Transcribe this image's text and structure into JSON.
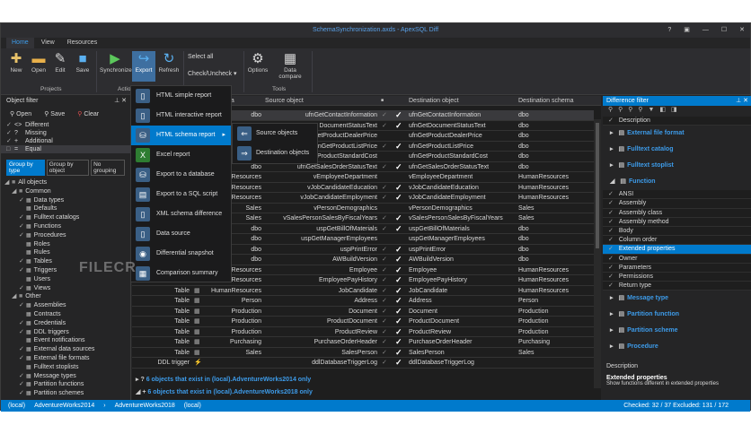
{
  "window": {
    "title": "SchemaSynchronization.axds - ApexSQL Diff",
    "buttons": [
      "?",
      "▣",
      "—",
      "☐",
      "✕"
    ]
  },
  "tabs": [
    "Home",
    "View",
    "Resources"
  ],
  "ribbon": {
    "new": "New",
    "open": "Open",
    "edit": "Edit",
    "save": "Save",
    "synchronize": "Synchronize",
    "export": "Export",
    "refresh": "Refresh",
    "select_all": "Select all",
    "check_uncheck": "Check/Uncheck ▾",
    "options": "Options",
    "data_compare": "Data compare",
    "groups": {
      "projects": "Projects",
      "action": "Action",
      "tools": "Tools"
    }
  },
  "object_filter": {
    "title": "Object filter",
    "open": "Open",
    "save": "Save",
    "clear": "Clear",
    "status": [
      {
        "sym": "<>",
        "label": "Different",
        "checked": true
      },
      {
        "sym": "?",
        "label": "Missing",
        "checked": true
      },
      {
        "sym": "+",
        "label": "Additional",
        "checked": true
      },
      {
        "sym": "=",
        "label": "Equal",
        "checked": false
      }
    ],
    "grouping": [
      "Group by type",
      "Group by object",
      "No grouping"
    ],
    "tree": [
      {
        "label": "All objects",
        "level": 0
      },
      {
        "label": "Common",
        "level": 1
      },
      {
        "label": "Data types",
        "level": 2,
        "checked": true
      },
      {
        "label": "Defaults",
        "level": 2,
        "checked": false
      },
      {
        "label": "Fulltext catalogs",
        "level": 2,
        "checked": true
      },
      {
        "label": "Functions",
        "level": 2,
        "checked": true
      },
      {
        "label": "Procedures",
        "level": 2,
        "checked": true
      },
      {
        "label": "Roles",
        "level": 2,
        "checked": false
      },
      {
        "label": "Rules",
        "level": 2,
        "checked": false
      },
      {
        "label": "Tables",
        "level": 2,
        "checked": true
      },
      {
        "label": "Triggers",
        "level": 2,
        "checked": true
      },
      {
        "label": "Users",
        "level": 2,
        "checked": false
      },
      {
        "label": "Views",
        "level": 2,
        "checked": true
      },
      {
        "label": "Other",
        "level": 1
      },
      {
        "label": "Assemblies",
        "level": 2,
        "checked": true
      },
      {
        "label": "Contracts",
        "level": 2,
        "checked": false
      },
      {
        "label": "Credentials",
        "level": 2,
        "checked": true
      },
      {
        "label": "DDL triggers",
        "level": 2,
        "checked": true
      },
      {
        "label": "Event notifications",
        "level": 2,
        "checked": false
      },
      {
        "label": "External data sources",
        "level": 2,
        "checked": true
      },
      {
        "label": "External file formats",
        "level": 2,
        "checked": true
      },
      {
        "label": "Fulltext stoplists",
        "level": 2,
        "checked": false
      },
      {
        "label": "Message types",
        "level": 2,
        "checked": true
      },
      {
        "label": "Partition functions",
        "level": 2,
        "checked": true
      },
      {
        "label": "Partition schemes",
        "level": 2,
        "checked": true
      }
    ]
  },
  "grid": {
    "headers": {
      "schema": "na",
      "source_object": "Source object",
      "check": "■",
      "dest_object": "Destination object",
      "dest_schema": "Destination schema"
    },
    "rows": [
      {
        "type": "",
        "src_schema": "dbo",
        "src": "ufnGetContactInformation",
        "chk": true,
        "dst": "ufnGetContactInformation",
        "dst_schema": "dbo"
      },
      {
        "type": "",
        "src_schema": "",
        "src": "DocumentStatusText",
        "chk": true,
        "dst": "ufnGetDocumentStatusText",
        "dst_schema": "dbo"
      },
      {
        "type": "",
        "src_schema": "",
        "src": "etProductDealerPrice",
        "chk": false,
        "dst": "ufnGetProductDealerPrice",
        "dst_schema": "dbo"
      },
      {
        "type": "",
        "src_schema": "",
        "src": "fnGetProductListPrice",
        "chk": true,
        "dst": "ufnGetProductListPrice",
        "dst_schema": "dbo"
      },
      {
        "type": "",
        "src_schema": "",
        "src": "ufnGetProductStandardCost",
        "chk": false,
        "dst": "ufnGetProductStandardCost",
        "dst_schema": "dbo"
      },
      {
        "type": "",
        "src_schema": "dbo",
        "src": "ufnGetSalesOrderStatusText",
        "chk": true,
        "dst": "ufnGetSalesOrderStatusText",
        "dst_schema": "dbo"
      },
      {
        "type": "",
        "src_schema": "nResources",
        "src": "vEmployeeDepartment",
        "chk": false,
        "dst": "vEmployeeDepartment",
        "dst_schema": "HumanResources"
      },
      {
        "type": "",
        "src_schema": "nResources",
        "src": "vJobCandidateEducation",
        "chk": true,
        "dst": "vJobCandidateEducation",
        "dst_schema": "HumanResources"
      },
      {
        "type": "",
        "src_schema": "nResources",
        "src": "vJobCandidateEmployment",
        "chk": true,
        "dst": "vJobCandidateEmployment",
        "dst_schema": "HumanResources"
      },
      {
        "type": "",
        "src_schema": "Sales",
        "src": "vPersonDemographics",
        "chk": false,
        "dst": "vPersonDemographics",
        "dst_schema": "Sales"
      },
      {
        "type": "",
        "src_schema": "Sales",
        "src": "vSalesPersonSalesByFiscalYears",
        "chk": true,
        "dst": "vSalesPersonSalesByFiscalYears",
        "dst_schema": "Sales"
      },
      {
        "type": "",
        "src_schema": "dbo",
        "src": "uspGetBillOfMaterials",
        "chk": true,
        "dst": "uspGetBillOfMaterials",
        "dst_schema": "dbo"
      },
      {
        "type": "",
        "src_schema": "dbo",
        "src": "uspGetManagerEmployees",
        "chk": false,
        "dst": "uspGetManagerEmployees",
        "dst_schema": "dbo"
      },
      {
        "type": "",
        "src_schema": "dbo",
        "src": "uspPrintError",
        "chk": true,
        "dst": "uspPrintError",
        "dst_schema": "dbo"
      },
      {
        "type": "",
        "src_schema": "dbo",
        "src": "AWBuildVersion",
        "chk": true,
        "dst": "AWBuildVersion",
        "dst_schema": "dbo"
      },
      {
        "type": "",
        "src_schema": "nResources",
        "src": "Employee",
        "chk": true,
        "dst": "Employee",
        "dst_schema": "HumanResources"
      },
      {
        "type": "Table",
        "src_schema": "HumanResources",
        "src": "EmployeePayHistory",
        "chk": true,
        "dst": "EmployeePayHistory",
        "dst_schema": "HumanResources"
      },
      {
        "type": "Table",
        "src_schema": "HumanResources",
        "src": "JobCandidate",
        "chk": true,
        "dst": "JobCandidate",
        "dst_schema": "HumanResources"
      },
      {
        "type": "Table",
        "src_schema": "Person",
        "src": "Address",
        "chk": true,
        "dst": "Address",
        "dst_schema": "Person"
      },
      {
        "type": "Table",
        "src_schema": "Production",
        "src": "Document",
        "chk": true,
        "dst": "Document",
        "dst_schema": "Production"
      },
      {
        "type": "Table",
        "src_schema": "Production",
        "src": "ProductDocument",
        "chk": true,
        "dst": "ProductDocument",
        "dst_schema": "Production"
      },
      {
        "type": "Table",
        "src_schema": "Production",
        "src": "ProductReview",
        "chk": true,
        "dst": "ProductReview",
        "dst_schema": "Production"
      },
      {
        "type": "Table",
        "src_schema": "Purchasing",
        "src": "PurchaseOrderHeader",
        "chk": true,
        "dst": "PurchaseOrderHeader",
        "dst_schema": "Purchasing"
      },
      {
        "type": "Table",
        "src_schema": "Sales",
        "src": "SalesPerson",
        "chk": true,
        "dst": "SalesPerson",
        "dst_schema": "Sales"
      },
      {
        "type": "DDL trigger",
        "src_schema": "",
        "src": "ddlDatabaseTriggerLog",
        "chk": true,
        "dst": "ddlDatabaseTriggerLog",
        "dst_schema": ""
      }
    ],
    "groups": [
      "6 objects that exist in (local).AdventureWorks2014 only",
      "6 objects that exist in (local).AdventureWorks2018 only"
    ]
  },
  "export_menu": {
    "items": [
      "HTML simple report",
      "HTML interactive report",
      "HTML schema report",
      "Excel report",
      "Export to a database",
      "Export to a SQL script",
      "XML schema difference",
      "Data source",
      "Differential snapshot",
      "Comparison summary"
    ],
    "submenu": [
      "Source objects",
      "Destination objects"
    ]
  },
  "difference_filter": {
    "title": "Difference filter",
    "top_item": "Description",
    "groups_before": [
      "External file format",
      "Fulltext catalog",
      "Fulltext stoplist"
    ],
    "expanded_group": "Function",
    "items": [
      "ANSI",
      "Assembly",
      "Assembly class",
      "Assembly method",
      "Body",
      "Column order",
      "Extended properties",
      "Owner",
      "Parameters",
      "Permissions",
      "Return type"
    ],
    "selected": "Extended properties",
    "groups_after": [
      "Message type",
      "Partition function",
      "Partition scheme",
      "Procedure"
    ],
    "desc_label": "Description",
    "desc_title": "Extended properties",
    "desc_text": "Show functions different in extended properties"
  },
  "status": {
    "src_server": "(local)",
    "src_db": "AdventureWorks2014",
    "dst_db": "AdventureWorks2018",
    "dst_server": "(local)",
    "right": "Checked: 32 / 37   Excluded: 131 / 172"
  },
  "watermark": "FILECR"
}
